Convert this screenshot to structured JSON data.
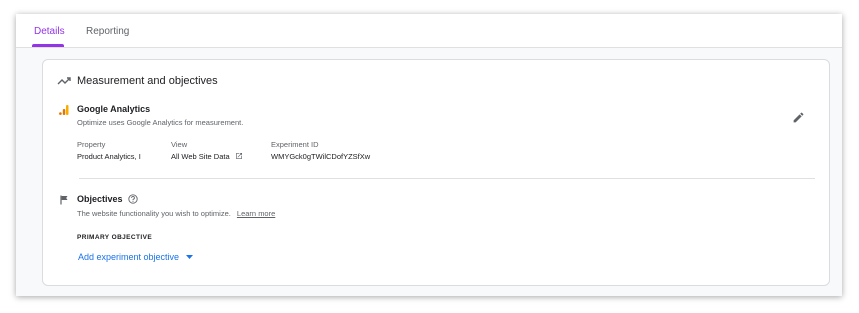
{
  "tabs": [
    {
      "label": "Details",
      "active": true
    },
    {
      "label": "Reporting",
      "active": false
    }
  ],
  "measurement": {
    "section_title": "Measurement and objectives",
    "analytics": {
      "title": "Google Analytics",
      "subtitle": "Optimize uses Google Analytics for measurement.",
      "property_label": "Property",
      "property_value": "Product Analytics, I",
      "view_label": "View",
      "view_value": "All Web Site Data",
      "experiment_id_label": "Experiment ID",
      "experiment_id_value": "WMYGck0gTWilCDofYZSfXw"
    }
  },
  "objectives": {
    "title": "Objectives",
    "description": "The website functionality you wish to optimize.",
    "learn_more": "Learn more",
    "primary_label": "PRIMARY OBJECTIVE",
    "add_button": "Add experiment objective"
  },
  "colors": {
    "accent": "#9334e6",
    "link_blue": "#1a73e8",
    "analytics_orange": "#f9ab00",
    "analytics_dark_orange": "#e37400"
  },
  "icons": [
    "trending-up-icon",
    "google-analytics-icon",
    "edit-pencil-icon",
    "open-in-new-icon",
    "flag-icon",
    "help-circle-icon",
    "dropdown-arrow-icon"
  ]
}
